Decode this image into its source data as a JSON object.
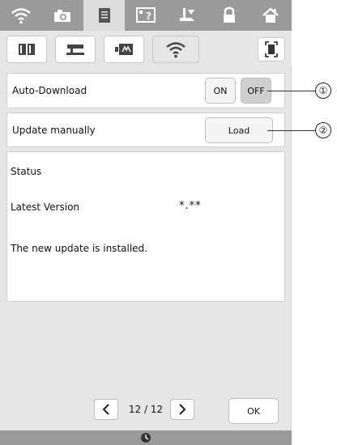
{
  "top_tabs": [
    {
      "icon": "wifi-icon",
      "active": false
    },
    {
      "icon": "camera-icon",
      "active": false
    },
    {
      "icon": "document-icon",
      "active": true
    },
    {
      "icon": "help-icon",
      "active": false
    },
    {
      "icon": "presser-foot-icon",
      "active": false
    },
    {
      "icon": "lock-icon",
      "active": false
    },
    {
      "icon": "home-icon",
      "active": false
    }
  ],
  "sub_tabs": [
    {
      "icon": "book-icon",
      "active": false
    },
    {
      "icon": "sewing-machine-icon",
      "active": false
    },
    {
      "icon": "embroidery-unit-icon",
      "active": false
    },
    {
      "icon": "wifi-icon",
      "active": true
    }
  ],
  "auto_download": {
    "label": "Auto-Download",
    "on_label": "ON",
    "off_label": "OFF",
    "selected": "OFF"
  },
  "update_manually": {
    "label": "Update manually",
    "load_label": "Load"
  },
  "status": {
    "heading": "Status",
    "latest_version_label": "Latest Version",
    "latest_version_value": "*.**",
    "message": "The new update is installed."
  },
  "pager": {
    "text": "12 / 12"
  },
  "ok_label": "OK",
  "callouts": [
    "①",
    "②"
  ]
}
